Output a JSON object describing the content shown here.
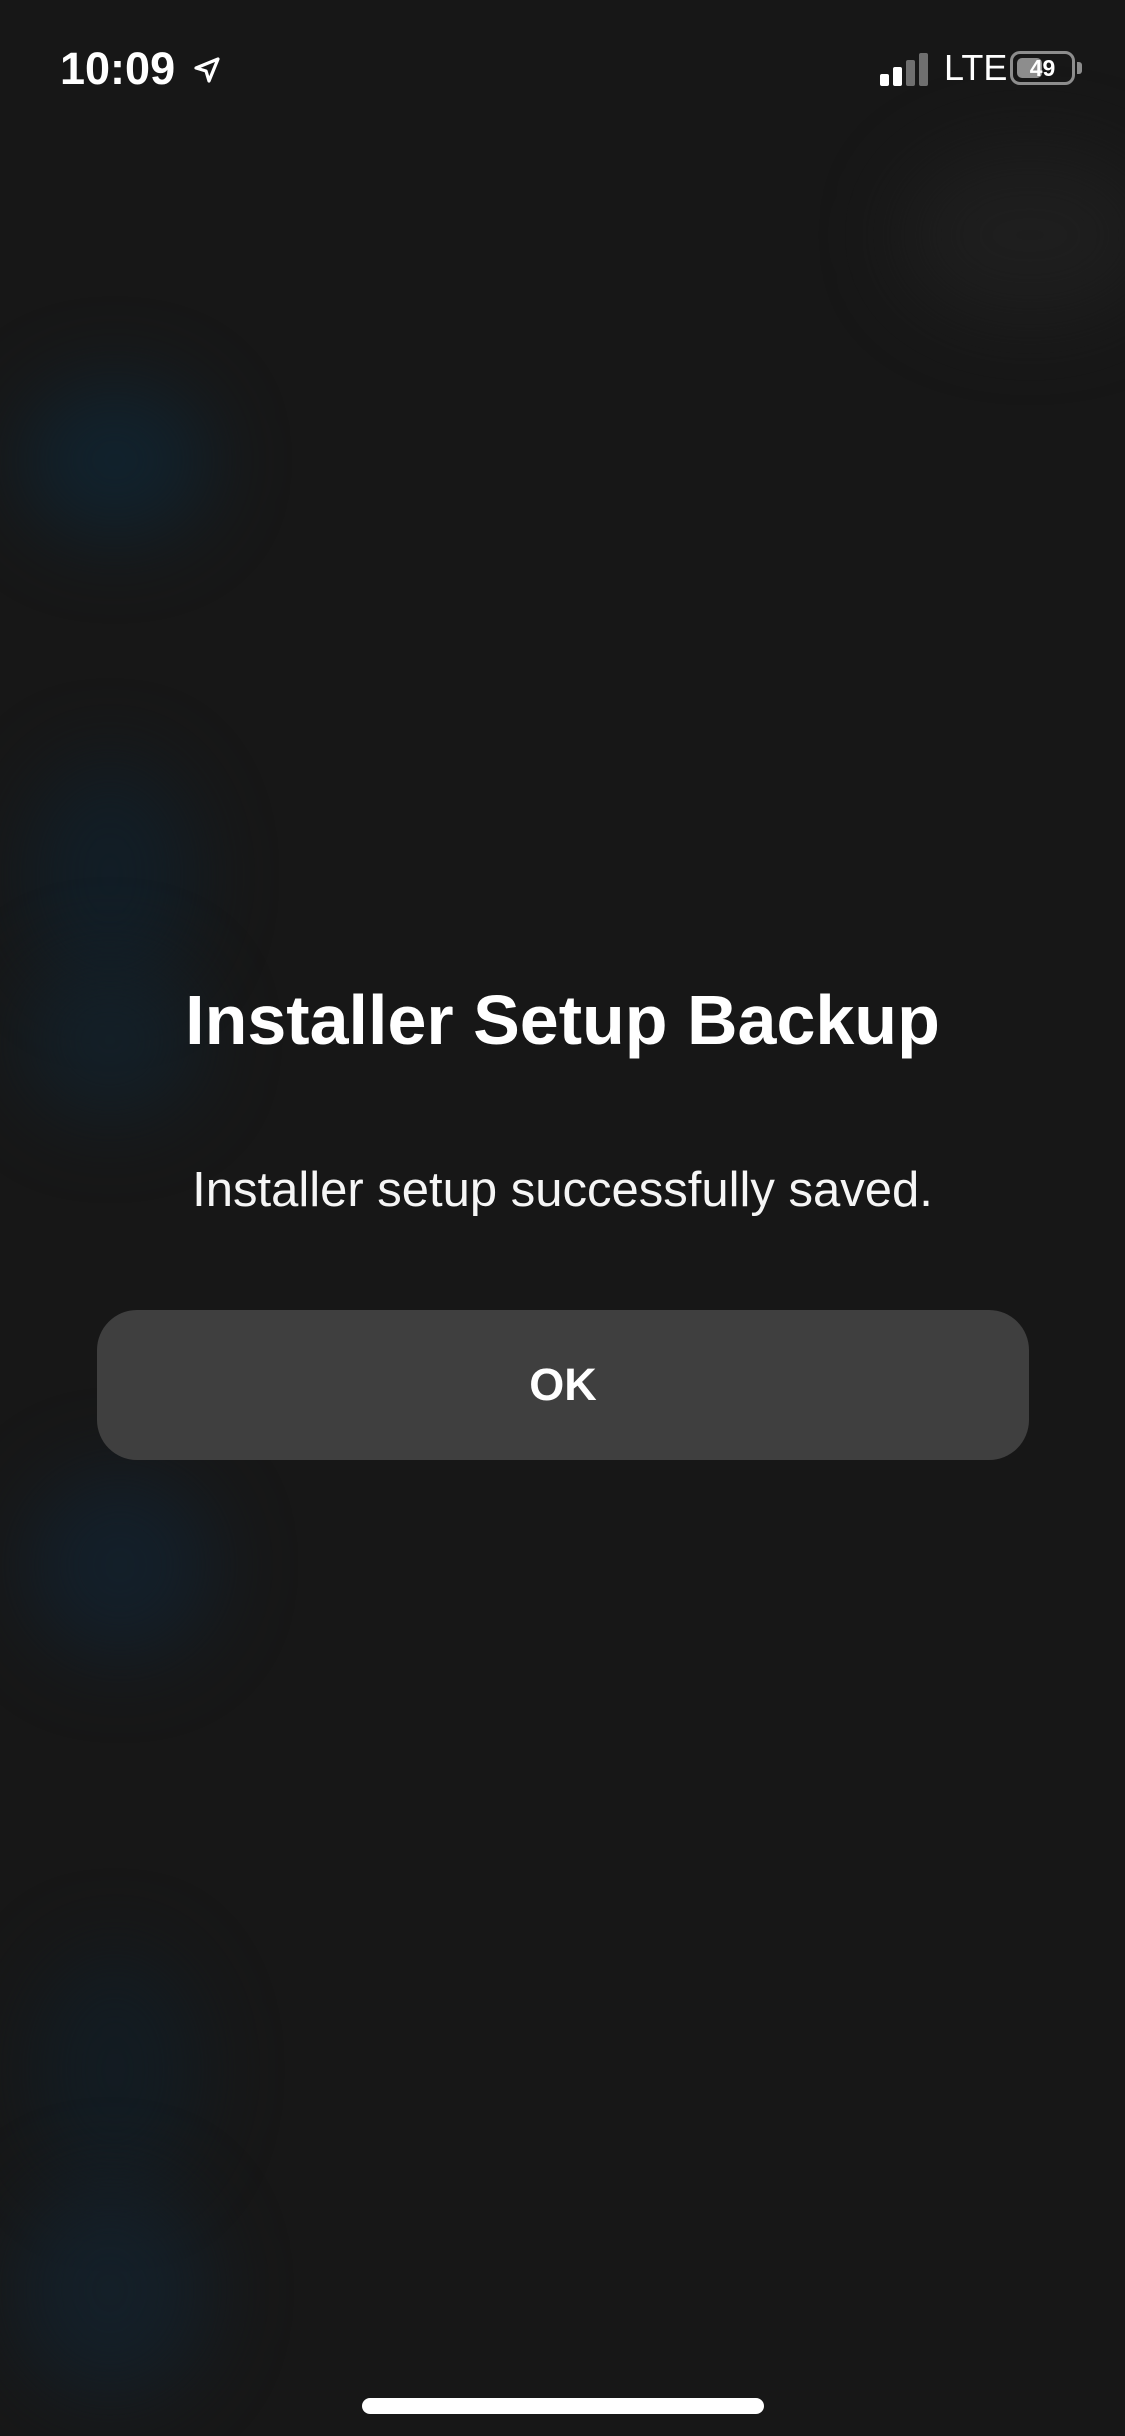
{
  "status_bar": {
    "time": "10:09",
    "network": "LTE",
    "battery_level": "49",
    "battery_level_percent": 49,
    "location_icon": "location-arrow-icon",
    "signal_icon": "signal-strength-icon",
    "signal_active_bars": 2,
    "signal_total_bars": 4
  },
  "dialog": {
    "title": "Installer Setup Backup",
    "message": "Installer setup successfully saved.",
    "ok_label": "OK"
  },
  "colors": {
    "background": "#171717",
    "button_background": "#3f3f3f",
    "text": "#ffffff",
    "battery_outline": "#8d8d8d",
    "ambient_glow": "#102431"
  }
}
